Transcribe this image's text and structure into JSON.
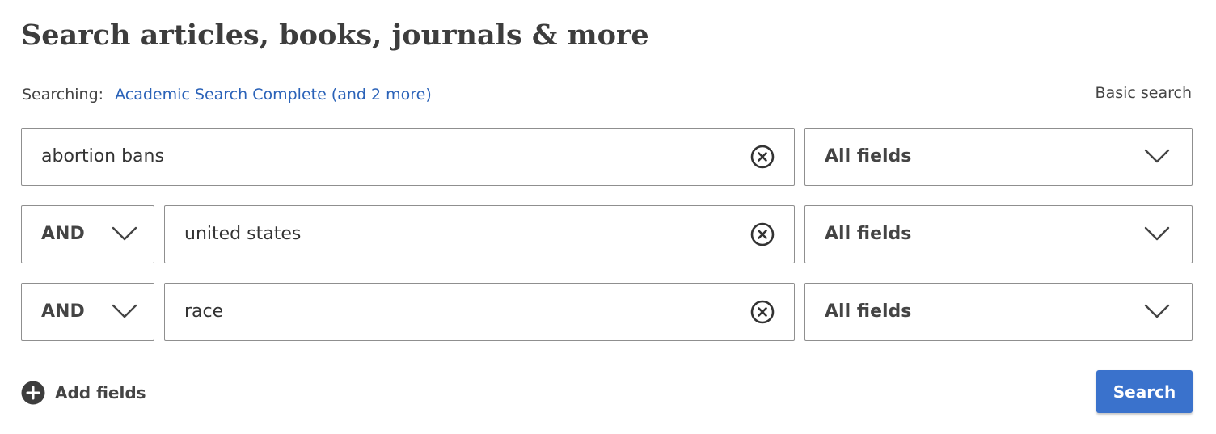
{
  "title": "Search articles, books, journals & more",
  "searching": {
    "label": "Searching:",
    "databases_link": "Academic Search Complete (and 2 more)"
  },
  "basic_search_label": "Basic search",
  "rows": [
    {
      "operator": null,
      "query": "abortion bans",
      "field": "All fields"
    },
    {
      "operator": "AND",
      "query": "united states",
      "field": "All fields"
    },
    {
      "operator": "AND",
      "query": "race",
      "field": "All fields"
    }
  ],
  "add_fields_label": "Add fields",
  "search_button_label": "Search",
  "icons": {
    "clear": "clear-circle-x-icon",
    "dropdown": "chevron-down-icon",
    "add": "plus-circle-icon"
  },
  "colors": {
    "link": "#2a62b8",
    "primary_button": "#3a72cc",
    "border": "#8f8f8f",
    "text": "#333333"
  }
}
